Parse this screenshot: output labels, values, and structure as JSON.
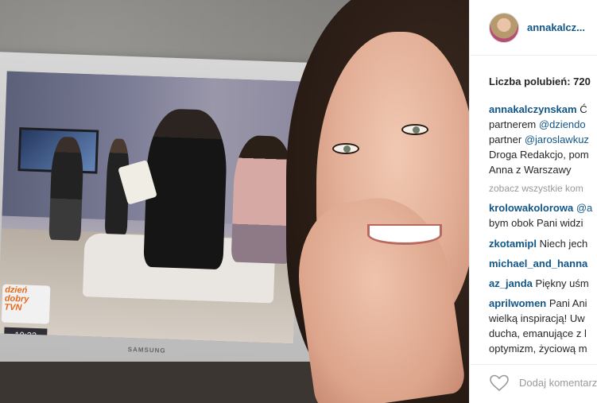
{
  "post": {
    "username": "annakalcz...",
    "likes_label": "Liczba polubień: 720",
    "caption": {
      "user": "annakalczynskam",
      "text1": " Ć",
      "line2_pre": "partnerem ",
      "line2_mention": "@dziendo",
      "line3_pre": "partner ",
      "line3_mention": "@jaroslawkuz",
      "line4": "Droga Redakcjo, pom",
      "line5": "Anna z Warszawy"
    },
    "view_all_comments": "zobacz wszystkie kom",
    "comments": [
      {
        "user": "krolowakolorowa",
        "text": " @a",
        "text2": "bym obok Pani widzi"
      },
      {
        "user": "zkotamipl",
        "text": " Niech jech"
      },
      {
        "user": "michael_and_hanna",
        "text": ""
      },
      {
        "user": "az_janda",
        "text": " Piękny uśm"
      },
      {
        "user": "aprilwomen",
        "text": " Pani Ani",
        "text2": "wielką inspiracją! Uw",
        "text3": "ducha, emanujące z l",
        "text4": "optymizm, życiową m"
      }
    ],
    "add_comment_placeholder": "Dodaj komentarz..."
  },
  "photo": {
    "tv_logo_lines": [
      "dzień",
      "dobry",
      "TVN"
    ],
    "tv_clock": "10:33",
    "tv_brand": "SAMSUNG"
  },
  "colors": {
    "link": "#125688",
    "text": "#262626",
    "muted": "#999999"
  },
  "icons": {
    "like": "heart-icon"
  }
}
